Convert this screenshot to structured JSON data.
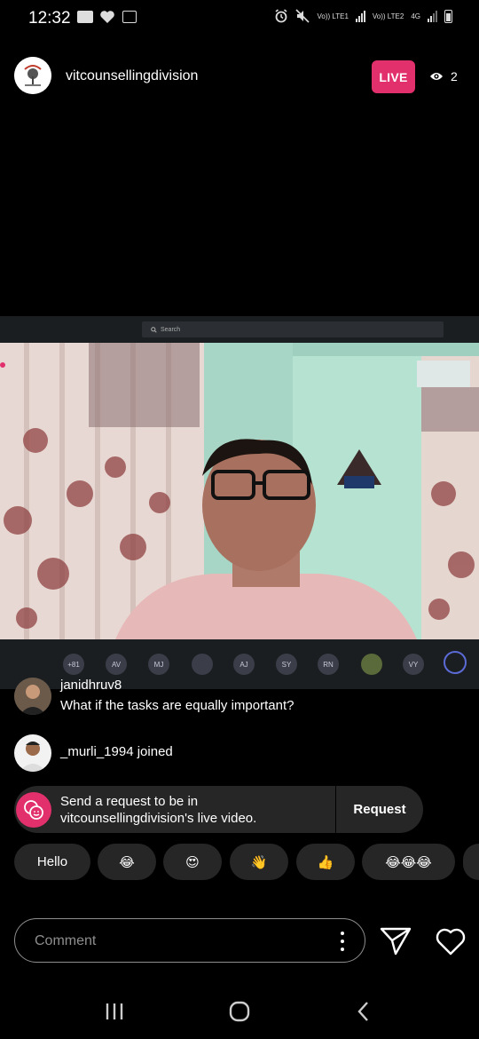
{
  "status_bar": {
    "time": "12:32",
    "carrier1": "Vo)) LTE1",
    "carrier2": "Vo)) LTE2",
    "network": "4G"
  },
  "header": {
    "channel_name": "vitcounsellingdivision",
    "live_label": "LIVE",
    "viewer_count": "2"
  },
  "video": {
    "search_placeholder": "Search",
    "participants": [
      "+81",
      "AV",
      "MJ",
      "",
      "AJ",
      "SY",
      "RN",
      "",
      "VY"
    ]
  },
  "comments": [
    {
      "user": "janidhruv8",
      "text": "What if the tasks are equally important?"
    },
    {
      "user": "_murli_1994",
      "text": "_murli_1994 joined"
    }
  ],
  "request": {
    "line1": "Send a request to be in",
    "line2": "vitcounsellingdivision's live video.",
    "button_label": "Request"
  },
  "quick_replies": [
    "Hello",
    "😂",
    "😍",
    "👋",
    "👍",
    "😂😂😂"
  ],
  "composer": {
    "placeholder": "Comment"
  },
  "colors": {
    "accent": "#e1306c",
    "chip_bg": "#262626",
    "background": "#000000"
  }
}
